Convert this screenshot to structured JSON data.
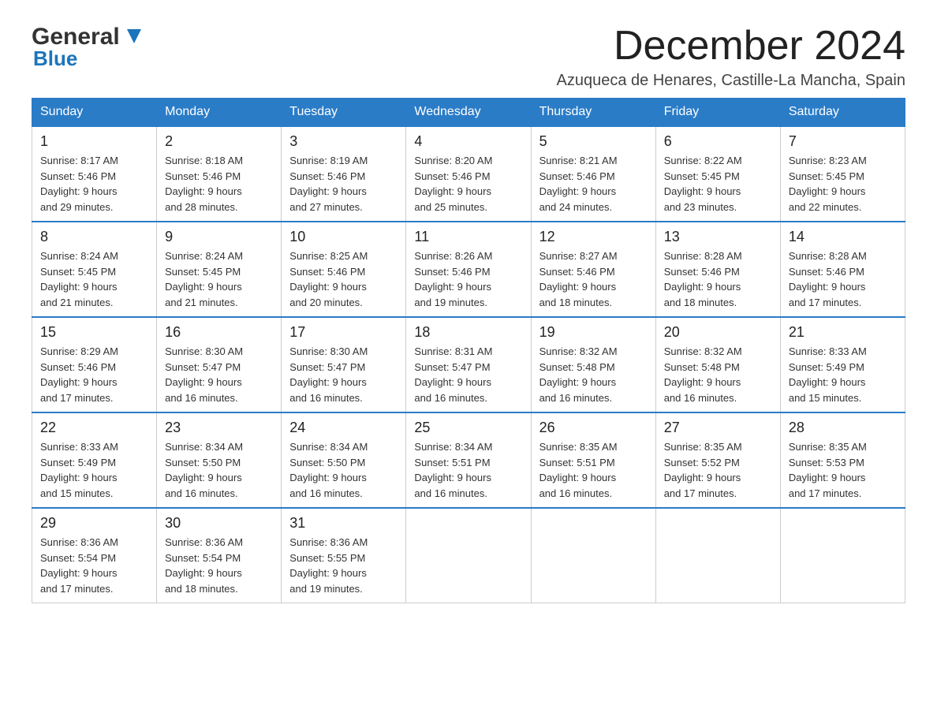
{
  "header": {
    "logo_general": "General",
    "logo_blue": "Blue",
    "month_title": "December 2024",
    "location": "Azuqueca de Henares, Castille-La Mancha, Spain"
  },
  "days_of_week": [
    "Sunday",
    "Monday",
    "Tuesday",
    "Wednesday",
    "Thursday",
    "Friday",
    "Saturday"
  ],
  "weeks": [
    [
      {
        "num": "1",
        "sunrise": "8:17 AM",
        "sunset": "5:46 PM",
        "daylight": "9 hours and 29 minutes."
      },
      {
        "num": "2",
        "sunrise": "8:18 AM",
        "sunset": "5:46 PM",
        "daylight": "9 hours and 28 minutes."
      },
      {
        "num": "3",
        "sunrise": "8:19 AM",
        "sunset": "5:46 PM",
        "daylight": "9 hours and 27 minutes."
      },
      {
        "num": "4",
        "sunrise": "8:20 AM",
        "sunset": "5:46 PM",
        "daylight": "9 hours and 25 minutes."
      },
      {
        "num": "5",
        "sunrise": "8:21 AM",
        "sunset": "5:46 PM",
        "daylight": "9 hours and 24 minutes."
      },
      {
        "num": "6",
        "sunrise": "8:22 AM",
        "sunset": "5:45 PM",
        "daylight": "9 hours and 23 minutes."
      },
      {
        "num": "7",
        "sunrise": "8:23 AM",
        "sunset": "5:45 PM",
        "daylight": "9 hours and 22 minutes."
      }
    ],
    [
      {
        "num": "8",
        "sunrise": "8:24 AM",
        "sunset": "5:45 PM",
        "daylight": "9 hours and 21 minutes."
      },
      {
        "num": "9",
        "sunrise": "8:24 AM",
        "sunset": "5:45 PM",
        "daylight": "9 hours and 21 minutes."
      },
      {
        "num": "10",
        "sunrise": "8:25 AM",
        "sunset": "5:46 PM",
        "daylight": "9 hours and 20 minutes."
      },
      {
        "num": "11",
        "sunrise": "8:26 AM",
        "sunset": "5:46 PM",
        "daylight": "9 hours and 19 minutes."
      },
      {
        "num": "12",
        "sunrise": "8:27 AM",
        "sunset": "5:46 PM",
        "daylight": "9 hours and 18 minutes."
      },
      {
        "num": "13",
        "sunrise": "8:28 AM",
        "sunset": "5:46 PM",
        "daylight": "9 hours and 18 minutes."
      },
      {
        "num": "14",
        "sunrise": "8:28 AM",
        "sunset": "5:46 PM",
        "daylight": "9 hours and 17 minutes."
      }
    ],
    [
      {
        "num": "15",
        "sunrise": "8:29 AM",
        "sunset": "5:46 PM",
        "daylight": "9 hours and 17 minutes."
      },
      {
        "num": "16",
        "sunrise": "8:30 AM",
        "sunset": "5:47 PM",
        "daylight": "9 hours and 16 minutes."
      },
      {
        "num": "17",
        "sunrise": "8:30 AM",
        "sunset": "5:47 PM",
        "daylight": "9 hours and 16 minutes."
      },
      {
        "num": "18",
        "sunrise": "8:31 AM",
        "sunset": "5:47 PM",
        "daylight": "9 hours and 16 minutes."
      },
      {
        "num": "19",
        "sunrise": "8:32 AM",
        "sunset": "5:48 PM",
        "daylight": "9 hours and 16 minutes."
      },
      {
        "num": "20",
        "sunrise": "8:32 AM",
        "sunset": "5:48 PM",
        "daylight": "9 hours and 16 minutes."
      },
      {
        "num": "21",
        "sunrise": "8:33 AM",
        "sunset": "5:49 PM",
        "daylight": "9 hours and 15 minutes."
      }
    ],
    [
      {
        "num": "22",
        "sunrise": "8:33 AM",
        "sunset": "5:49 PM",
        "daylight": "9 hours and 15 minutes."
      },
      {
        "num": "23",
        "sunrise": "8:34 AM",
        "sunset": "5:50 PM",
        "daylight": "9 hours and 16 minutes."
      },
      {
        "num": "24",
        "sunrise": "8:34 AM",
        "sunset": "5:50 PM",
        "daylight": "9 hours and 16 minutes."
      },
      {
        "num": "25",
        "sunrise": "8:34 AM",
        "sunset": "5:51 PM",
        "daylight": "9 hours and 16 minutes."
      },
      {
        "num": "26",
        "sunrise": "8:35 AM",
        "sunset": "5:51 PM",
        "daylight": "9 hours and 16 minutes."
      },
      {
        "num": "27",
        "sunrise": "8:35 AM",
        "sunset": "5:52 PM",
        "daylight": "9 hours and 17 minutes."
      },
      {
        "num": "28",
        "sunrise": "8:35 AM",
        "sunset": "5:53 PM",
        "daylight": "9 hours and 17 minutes."
      }
    ],
    [
      {
        "num": "29",
        "sunrise": "8:36 AM",
        "sunset": "5:54 PM",
        "daylight": "9 hours and 17 minutes."
      },
      {
        "num": "30",
        "sunrise": "8:36 AM",
        "sunset": "5:54 PM",
        "daylight": "9 hours and 18 minutes."
      },
      {
        "num": "31",
        "sunrise": "8:36 AM",
        "sunset": "5:55 PM",
        "daylight": "9 hours and 19 minutes."
      },
      null,
      null,
      null,
      null
    ]
  ],
  "labels": {
    "sunrise": "Sunrise: ",
    "sunset": "Sunset: ",
    "daylight": "Daylight: "
  }
}
